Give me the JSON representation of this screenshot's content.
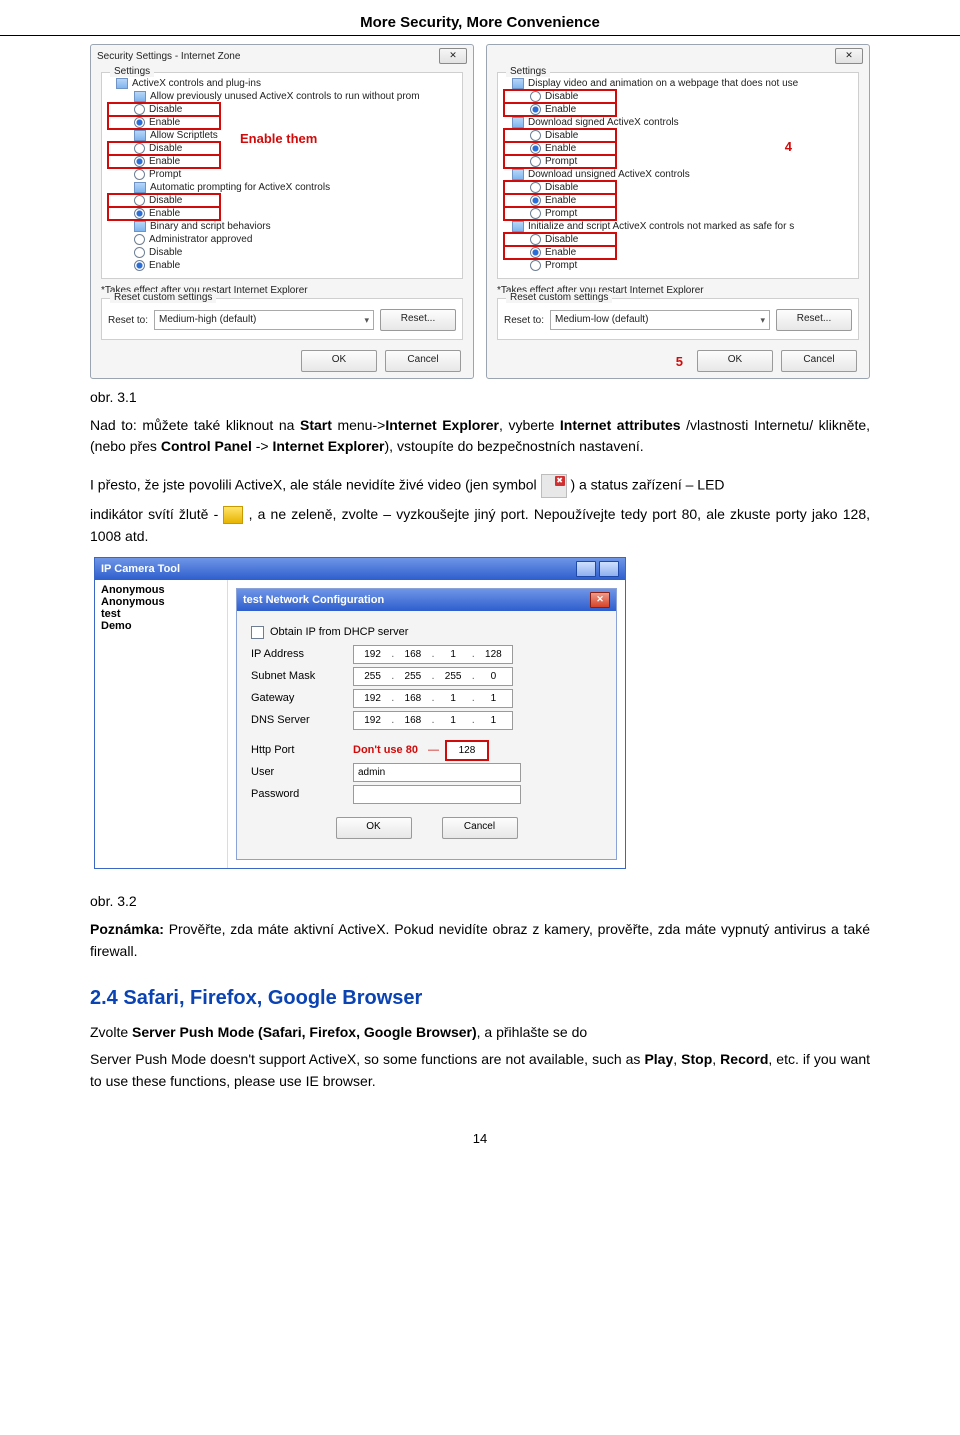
{
  "header": "More Security, More Convenience",
  "dlgA": {
    "title": "Security Settings - Internet Zone",
    "groupCaption": "Settings",
    "items": [
      {
        "l": 1,
        "t": "cat",
        "txt": "ActiveX controls and plug-ins"
      },
      {
        "l": 2,
        "t": "cat",
        "txt": "Allow previously unused ActiveX controls to run without prom"
      },
      {
        "l": 2,
        "t": "rad",
        "sel": false,
        "txt": "Disable",
        "box": true
      },
      {
        "l": 2,
        "t": "rad",
        "sel": true,
        "txt": "Enable",
        "box": true
      },
      {
        "l": 2,
        "t": "cat",
        "txt": "Allow Scriptlets"
      },
      {
        "l": 2,
        "t": "rad",
        "sel": false,
        "txt": "Disable",
        "box": true
      },
      {
        "l": 2,
        "t": "rad",
        "sel": true,
        "txt": "Enable",
        "box": true
      },
      {
        "l": 2,
        "t": "rad",
        "sel": false,
        "txt": "Prompt"
      },
      {
        "l": 2,
        "t": "cat",
        "txt": "Automatic prompting for ActiveX controls"
      },
      {
        "l": 2,
        "t": "rad",
        "sel": false,
        "txt": "Disable",
        "box": true
      },
      {
        "l": 2,
        "t": "rad",
        "sel": true,
        "txt": "Enable",
        "box": true
      },
      {
        "l": 2,
        "t": "cat",
        "txt": "Binary and script behaviors"
      },
      {
        "l": 2,
        "t": "rad",
        "sel": false,
        "txt": "Administrator approved"
      },
      {
        "l": 2,
        "t": "rad",
        "sel": false,
        "txt": "Disable"
      },
      {
        "l": 2,
        "t": "rad",
        "sel": true,
        "txt": "Enable"
      }
    ],
    "annot": "Enable them",
    "note": "*Takes effect after you restart Internet Explorer",
    "resetCaption": "Reset custom settings",
    "resetLabel": "Reset to:",
    "resetCombo": "Medium-high (default)",
    "resetBtn": "Reset...",
    "ok": "OK",
    "cancel": "Cancel"
  },
  "dlgB": {
    "title": "Settings",
    "items": [
      {
        "l": 1,
        "t": "cat",
        "txt": "Display video and animation on a webpage that does not use"
      },
      {
        "l": 2,
        "t": "rad",
        "sel": false,
        "txt": "Disable",
        "box": true
      },
      {
        "l": 2,
        "t": "rad",
        "sel": true,
        "txt": "Enable",
        "box": true
      },
      {
        "l": 1,
        "t": "cat",
        "txt": "Download signed ActiveX controls"
      },
      {
        "l": 2,
        "t": "rad",
        "sel": false,
        "txt": "Disable",
        "box": true
      },
      {
        "l": 2,
        "t": "rad",
        "sel": true,
        "txt": "Enable",
        "box": true
      },
      {
        "l": 2,
        "t": "rad",
        "sel": false,
        "txt": "Prompt",
        "box": true
      },
      {
        "l": 1,
        "t": "cat",
        "txt": "Download unsigned ActiveX controls"
      },
      {
        "l": 2,
        "t": "rad",
        "sel": false,
        "txt": "Disable",
        "box": true
      },
      {
        "l": 2,
        "t": "rad",
        "sel": true,
        "txt": "Enable",
        "box": true
      },
      {
        "l": 2,
        "t": "rad",
        "sel": false,
        "txt": "Prompt",
        "box": true
      },
      {
        "l": 1,
        "t": "cat",
        "txt": "Initialize and script ActiveX controls not marked as safe for s"
      },
      {
        "l": 2,
        "t": "rad",
        "sel": false,
        "txt": "Disable",
        "box": true
      },
      {
        "l": 2,
        "t": "rad",
        "sel": true,
        "txt": "Enable",
        "box": true
      },
      {
        "l": 2,
        "t": "rad",
        "sel": false,
        "txt": "Prompt"
      }
    ],
    "annot": "4",
    "note": "*Takes effect after you restart Internet Explorer",
    "resetCaption": "Reset custom settings",
    "resetLabel": "Reset to:",
    "resetCombo": "Medium-low (default)",
    "resetBtn": "Reset...",
    "five": "5",
    "ok": "OK",
    "cancel": "Cancel"
  },
  "caption31": "obr. 3.1",
  "para1a": "Nad to: můžete také kliknout na ",
  "para1b": " menu->",
  "para1c": ", vyberte ",
  "para1d": " /vlastnosti Internetu/ klikněte, (nebo přes ",
  "para1e": " -> ",
  "para1f": "), vstoupíte do bezpečnostních nastavení.",
  "start": "Start",
  "ie": "Internet Explorer",
  "ia": "Internet attributes",
  "cp": "Control Panel",
  "para2a": "I přesto, že jste povolili ActiveX, ale stále nevidíte živé video (jen symbol ",
  "para2b": " ) a status zařízení – LED",
  "para3a": "indikátor svítí žlutě - ",
  "para3b": ", a ne zeleně, zvolte – vyzkoušejte jiný port. Nepoužívejte tedy port 80, ale zkuste porty jako 128, 1008 atd.",
  "ipcam": {
    "title": "IP Camera Tool",
    "list": [
      "Anonymous",
      "Anonymous",
      "test",
      "Demo"
    ],
    "sub": {
      "title": "test Network Configuration",
      "dhcp": "Obtain IP from DHCP server",
      "rows": {
        "ip": {
          "lab": "IP Address",
          "v": [
            "192",
            "168",
            "1",
            "128"
          ]
        },
        "sm": {
          "lab": "Subnet Mask",
          "v": [
            "255",
            "255",
            "255",
            "0"
          ]
        },
        "gw": {
          "lab": "Gateway",
          "v": [
            "192",
            "168",
            "1",
            "1"
          ]
        },
        "dns": {
          "lab": "DNS Server",
          "v": [
            "192",
            "168",
            "1",
            "1"
          ]
        }
      },
      "httpPort": "Http Port",
      "httpPortHint": "Don't use 80",
      "httpPortVal": "128",
      "user": "User",
      "userVal": "admin",
      "pass": "Password",
      "ok": "OK",
      "cancel": "Cancel"
    }
  },
  "caption32": "obr. 3.2",
  "noteBold": "Poznámka:",
  "noteText": " Prověřte, zda máte aktivní ActiveX. Pokud nevidíte obraz z kamery, prověřte, zda máte vypnutý antivirus a také firewall.",
  "secTitle": "2.4 Safari, Firefox, Google Browser",
  "p4a": "Zvolte ",
  "p4bold": "Server Push Mode (Safari, Firefox, Google Browser)",
  "p4b": ", a přihlašte se do",
  "p5a": "Server Push Mode doesn't support ActiveX, so some functions are not available, such as ",
  "play": "Play",
  "stop": "Stop",
  "record": "Record",
  "p5b": ", etc. if you want to use these functions, please use IE browser.",
  "pageNum": "14"
}
